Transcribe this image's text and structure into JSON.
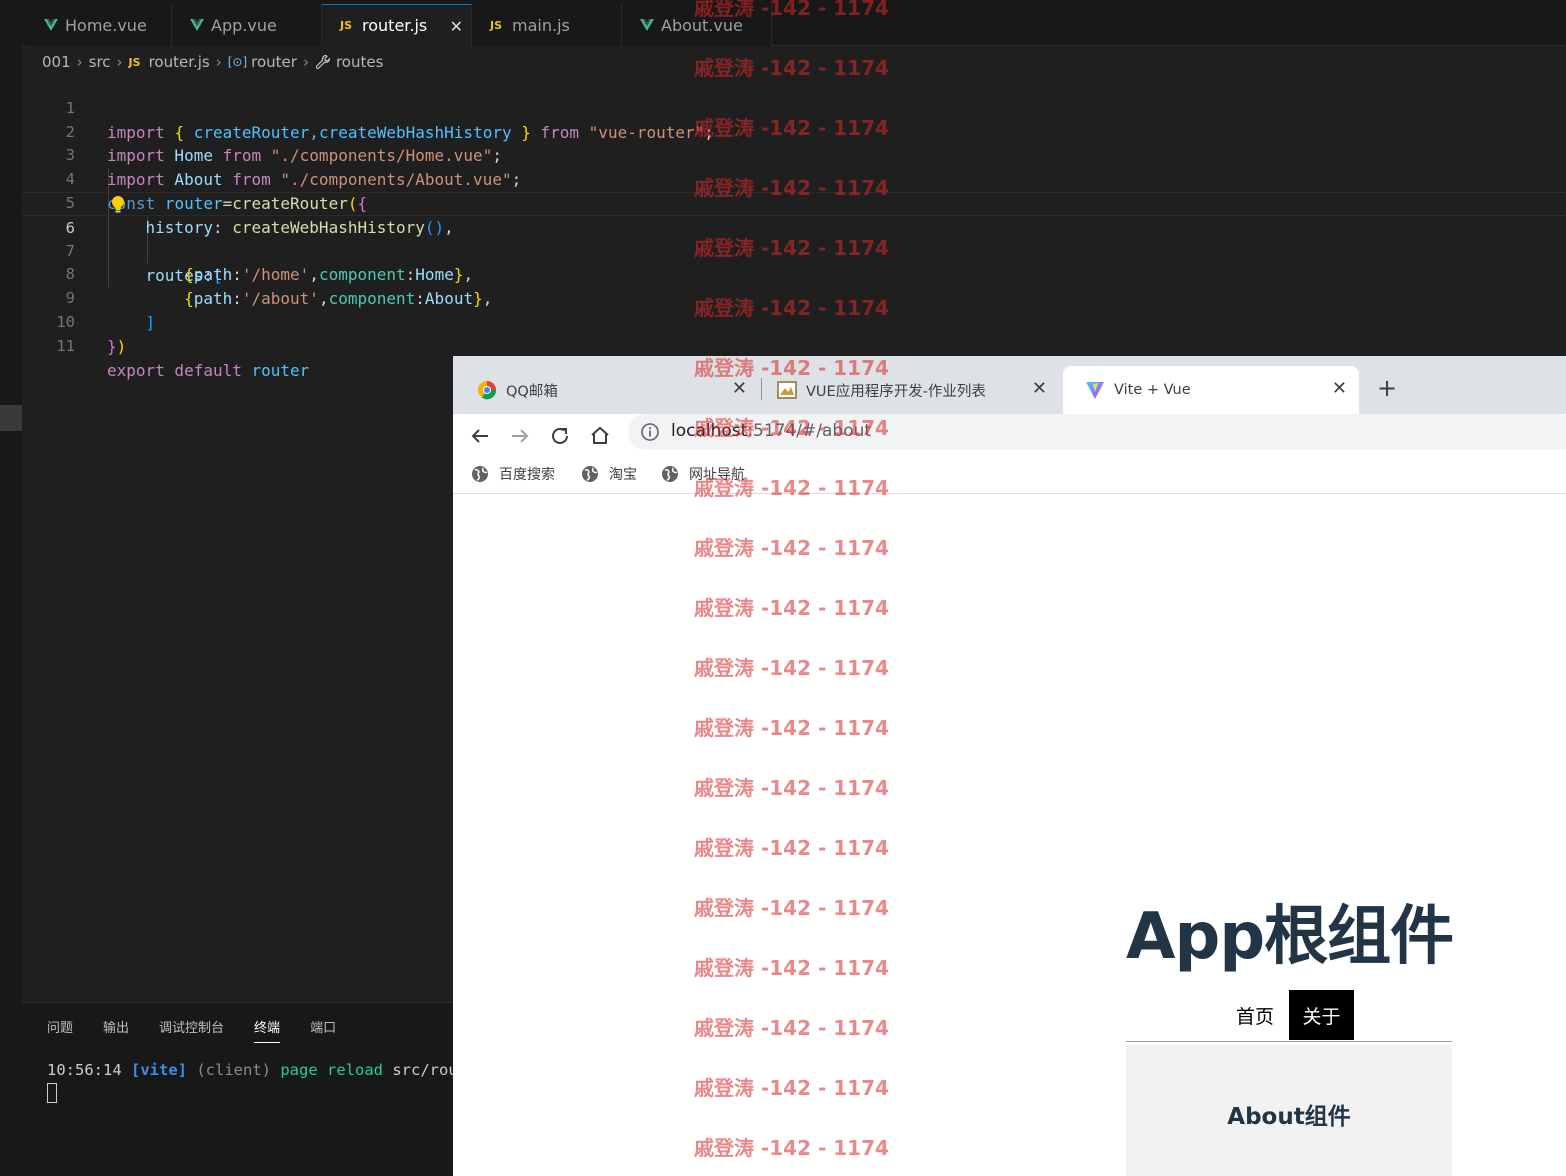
{
  "editor": {
    "tabs": [
      {
        "label": "Home.vue",
        "type": "vue"
      },
      {
        "label": "App.vue",
        "type": "vue"
      },
      {
        "label": "router.js",
        "type": "js",
        "active": true
      },
      {
        "label": "main.js",
        "type": "js"
      },
      {
        "label": "About.vue",
        "type": "vue"
      }
    ],
    "js_badge": "JS",
    "close_glyph": "✕",
    "breadcrumb": {
      "folder1": "001",
      "folder2": "src",
      "file": "router.js",
      "symbol": "router",
      "property": "routes",
      "symbol_glyph": "[⊙]"
    },
    "line_numbers": [
      "1",
      "2",
      "3",
      "4",
      "5",
      "6",
      "7",
      "8",
      "9",
      "10",
      "11"
    ],
    "current_line": 6,
    "code": {
      "l1": {
        "import": "import",
        "ob": "{",
        "a": " createRouter,createWebHashHistory ",
        "cb": "}",
        "from": " from ",
        "str": "\"vue-router\"",
        "semi": ";"
      },
      "l2": {
        "import": "import",
        "name": " Home",
        "from": " from ",
        "str": "\"./components/Home.vue\"",
        "semi": ";"
      },
      "l3": {
        "import": "import",
        "name": " About",
        "from": " from ",
        "str": "\"./components/About.vue\"",
        "semi": ";"
      },
      "l4": {
        "const": "const",
        "name": " router",
        "eq": "=",
        "fn": "createRouter",
        "p": "(",
        "b": "{"
      },
      "l5": {
        "indent": "    ",
        "key": "history",
        "colon": ": ",
        "fn": "createWebHashHistory",
        "paren": "()",
        "comma": ","
      },
      "l6": {
        "indent": "    ",
        "key": "routes",
        "colon": ":",
        "br": "["
      },
      "l7": {
        "indent": "        ",
        "ob": "{",
        "k1": "path",
        "c1": ":",
        "s1": "'/home'",
        "cm": ",",
        "k2": "component",
        "c2": ":",
        "v2": "Home",
        "cb": "}",
        "end": ","
      },
      "l8": {
        "indent": "        ",
        "ob": "{",
        "k1": "path",
        "c1": ":",
        "s1": "'/about'",
        "cm": ",",
        "k2": "component",
        "c2": ":",
        "v2": "About",
        "cb": "}",
        "end": ","
      },
      "l9": {
        "indent": "    ",
        "br": "]"
      },
      "l10": {
        "cb": "}",
        "p": ")"
      },
      "l11": {
        "export": "export",
        "default": " default",
        "name": " router"
      }
    },
    "panel_tabs": [
      "问题",
      "输出",
      "调试控制台",
      "终端",
      "端口"
    ],
    "active_panel_tab": "终端",
    "terminal": {
      "time": "10:56:14 ",
      "vite": "[vite]",
      "client": " (client)",
      "page": " page",
      "reload": " reload",
      "path": " src/rout"
    }
  },
  "browser": {
    "tabs": [
      {
        "label": "QQ邮箱"
      },
      {
        "label": "VUE应用程序开发-作业列表"
      },
      {
        "label": "Vite + Vue",
        "active": true
      }
    ],
    "close_glyph": "✕",
    "new_tab_glyph": "+",
    "url_host": "localhost",
    "url_rest": ":5174/#/about",
    "bookmarks": [
      "百度搜索",
      "淘宝",
      "网址导航"
    ],
    "page": {
      "title": "App根组件",
      "nav_home": "首页",
      "nav_about": "关于",
      "component_heading": "About组件"
    }
  },
  "watermark": {
    "text": "戚登涛 -142 - 1174",
    "count": 20,
    "color": "#d72828"
  },
  "colors": {
    "editor_bg": "#1f1f1f",
    "keyword": "#c586c0",
    "string": "#ce9178",
    "function": "#dcdcaa",
    "accent": "#0078d4",
    "vue_green": "#41b883",
    "page_text": "#213547"
  }
}
